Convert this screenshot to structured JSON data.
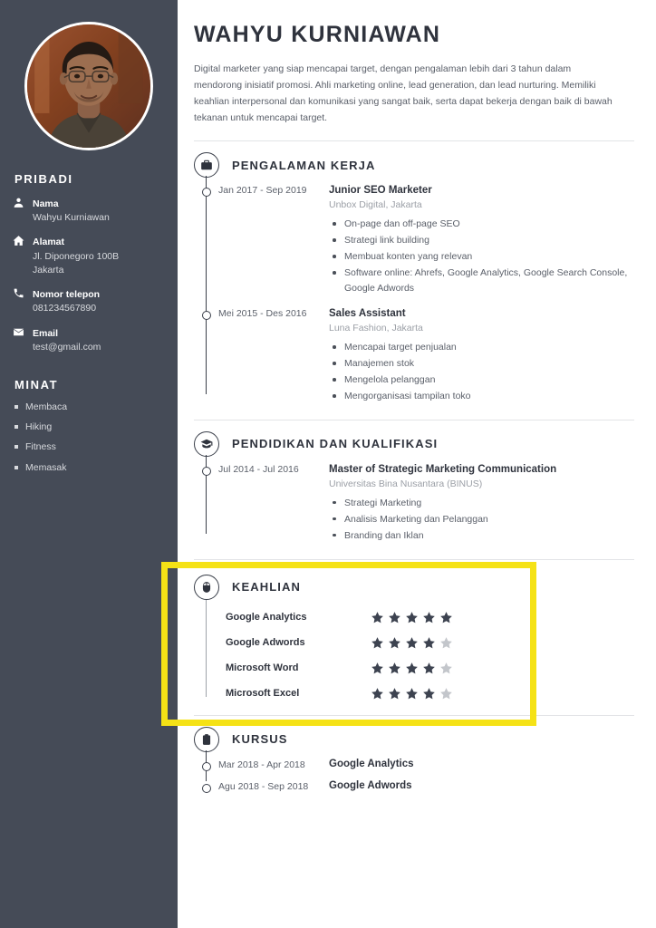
{
  "sidebar": {
    "avatar_alt": "profile-photo",
    "personal_heading": "PRIBADI",
    "contacts": [
      {
        "icon": "person-icon",
        "label": "Nama",
        "value": "Wahyu Kurniawan"
      },
      {
        "icon": "home-icon",
        "label": "Alamat",
        "value": "Jl. Diponegoro 100B\nJakarta"
      },
      {
        "icon": "phone-icon",
        "label": "Nomor telepon",
        "value": "081234567890"
      },
      {
        "icon": "envelope-icon",
        "label": "Email",
        "value": "test@gmail.com"
      }
    ],
    "interests_heading": "MINAT",
    "interests": [
      "Membaca",
      "Hiking",
      "Fitness",
      "Memasak"
    ],
    "bg_color": "#454b57"
  },
  "header": {
    "name": "WAHYU KURNIAWAN",
    "summary": "Digital marketer yang siap mencapai target, dengan pengalaman lebih dari 3 tahun dalam mendorong inisiatif promosi. Ahli marketing online, lead generation, dan lead nurturing. Memiliki keahlian interpersonal dan komunikasi yang sangat baik, serta dapat bekerja dengan baik di bawah tekanan untuk mencapai target."
  },
  "sections": {
    "experience": {
      "icon": "briefcase-icon",
      "title": "PENGALAMAN KERJA",
      "entries": [
        {
          "date": "Jan 2017 - Sep 2019",
          "title": "Junior SEO Marketer",
          "org": "Unbox Digital, Jakarta",
          "points": [
            "On-page dan off-page SEO",
            "Strategi link building",
            "Membuat konten yang relevan",
            "Software online: Ahrefs, Google Analytics, Google Search Console, Google Adwords"
          ]
        },
        {
          "date": "Mei 2015 - Des 2016",
          "title": "Sales Assistant",
          "org": "Luna Fashion, Jakarta",
          "points": [
            "Mencapai target penjualan",
            "Manajemen stok",
            "Mengelola pelanggan",
            "Mengorganisasi tampilan toko"
          ]
        }
      ]
    },
    "education": {
      "icon": "graduation-cap-icon",
      "title": "PENDIDIKAN DAN KUALIFIKASI",
      "entries": [
        {
          "date": "Jul 2014 - Jul 2016",
          "title": "Master of Strategic Marketing Communication",
          "org": "Universitas Bina Nusantara (BINUS)",
          "points": [
            "Strategi Marketing",
            "Analisis Marketing dan Pelanggan",
            "Branding dan Iklan"
          ]
        }
      ]
    },
    "skills": {
      "icon": "mouse-icon",
      "title": "KEAHLIAN",
      "max_rating": 5,
      "items": [
        {
          "name": "Google Analytics",
          "rating": 5
        },
        {
          "name": "Google Adwords",
          "rating": 4
        },
        {
          "name": "Microsoft Word",
          "rating": 4
        },
        {
          "name": "Microsoft Excel",
          "rating": 4
        }
      ],
      "star_filled_color": "#3d4350",
      "star_empty_color": "#c3c6cb",
      "highlighted": true,
      "highlight_color": "#f5e216"
    },
    "courses": {
      "icon": "clipboard-icon",
      "title": "KURSUS",
      "entries": [
        {
          "date": "Mar 2018 - Apr 2018",
          "title": "Google Analytics"
        },
        {
          "date": "Agu 2018 - Sep 2018",
          "title": "Google Adwords"
        }
      ]
    }
  }
}
